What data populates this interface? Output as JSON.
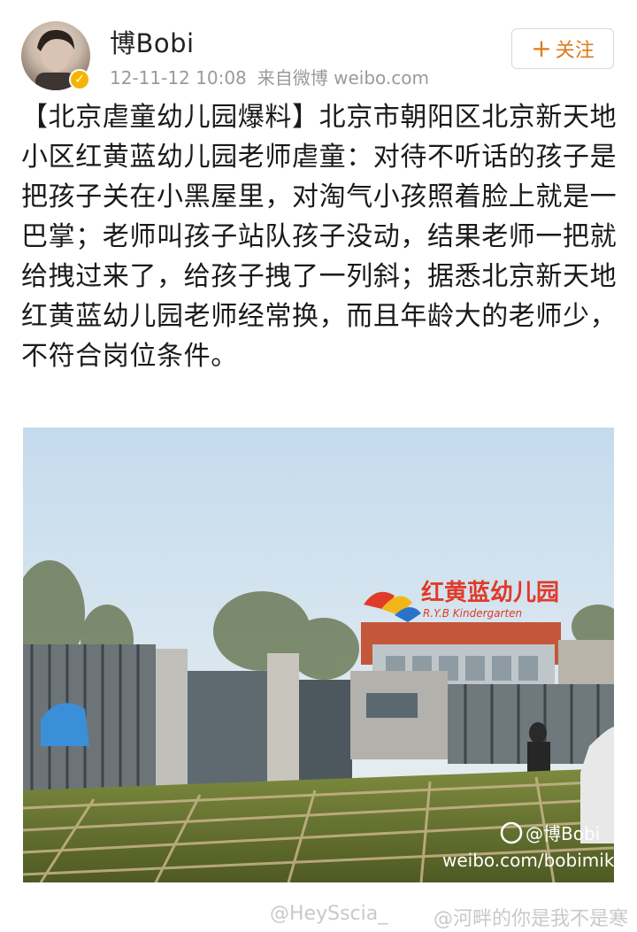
{
  "post": {
    "username": "博Bobi",
    "timestamp": "12-11-12 10:08",
    "source": "来自微博 weibo.com",
    "follow_label": "关注",
    "follow_plus": "+",
    "text": "【北京虐童幼儿园爆料】北京市朝阳区北京新天地小区红黄蓝幼儿园老师虐童：对待不听话的孩子是把孩子关在小黑屋里，对淘气小孩照着脸上就是一巴掌；老师叫孩子站队孩子没动，结果老师一把就给拽过来了，给孩子拽了一列斜；据悉北京新天地红黄蓝幼儿园老师经常换，而且年龄大的老师少，不符合岗位条件。"
  },
  "photo": {
    "sign_cn": "红黄蓝幼儿园",
    "sign_en": "R.Y.B Kindergarten",
    "watermark_user": "@博Bobi",
    "watermark_url": "weibo.com/bobimika"
  },
  "footer": {
    "watermark_1": "@HeySscia_",
    "watermark_2": "@河畔的你是我不是寒"
  },
  "colors": {
    "follow_accent": "#e07a1a",
    "verified_badge": "#f5b400"
  },
  "icons": {
    "verified": "verified-badge-icon",
    "follow_plus": "plus-icon",
    "weibo": "weibo-logo-icon"
  }
}
